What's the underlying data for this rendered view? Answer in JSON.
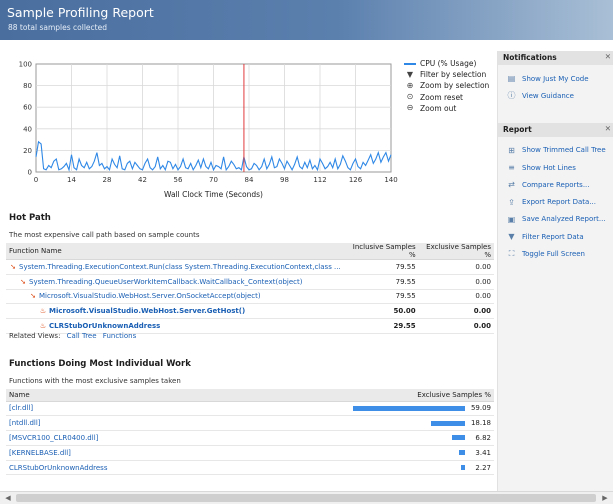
{
  "header": {
    "title": "Sample Profiling Report",
    "subtitle": "88 total samples collected"
  },
  "chart_data": {
    "type": "line",
    "title": "",
    "xlabel": "Wall Clock Time (Seconds)",
    "ylabel": "",
    "xlim": [
      0,
      140
    ],
    "ylim": [
      0,
      100
    ],
    "x_ticks": [
      0,
      14,
      28,
      42,
      56,
      70,
      84,
      98,
      112,
      126,
      140
    ],
    "y_ticks": [
      0,
      20,
      40,
      60,
      80,
      100
    ],
    "grid": true,
    "legend": "right",
    "selection_marker_x": 82,
    "series": [
      {
        "name": "CPU (% Usage)",
        "color": "#2f88e6",
        "x": [
          0,
          1,
          2,
          3,
          4,
          5,
          6,
          7,
          8,
          9,
          10,
          11,
          12,
          13,
          14,
          15,
          16,
          17,
          18,
          19,
          20,
          21,
          22,
          23,
          24,
          25,
          26,
          27,
          28,
          29,
          30,
          31,
          32,
          33,
          34,
          35,
          36,
          37,
          38,
          39,
          40,
          41,
          42,
          43,
          44,
          45,
          46,
          47,
          48,
          49,
          50,
          51,
          52,
          53,
          54,
          55,
          56,
          57,
          58,
          59,
          60,
          61,
          62,
          63,
          64,
          65,
          66,
          67,
          68,
          69,
          70,
          71,
          72,
          73,
          74,
          75,
          76,
          77,
          78,
          79,
          80,
          81,
          82,
          83,
          84,
          85,
          86,
          87,
          88,
          89,
          90,
          91,
          92,
          93,
          94,
          95,
          96,
          97,
          98,
          99,
          100,
          101,
          102,
          103,
          104,
          105,
          106,
          107,
          108,
          109,
          110,
          111,
          112,
          113,
          114,
          115,
          116,
          117,
          118,
          119,
          120,
          121,
          122,
          123,
          124,
          125,
          126,
          127,
          128,
          129,
          130,
          131,
          132,
          133,
          134,
          135,
          136,
          137,
          138,
          139,
          140
        ],
        "values": [
          14,
          28,
          26,
          3,
          2,
          6,
          4,
          10,
          12,
          2,
          3,
          5,
          8,
          2,
          16,
          4,
          2,
          12,
          6,
          4,
          9,
          3,
          5,
          10,
          18,
          6,
          8,
          3,
          5,
          2,
          12,
          7,
          4,
          15,
          3,
          2,
          8,
          10,
          3,
          9,
          6,
          3,
          2,
          8,
          12,
          4,
          2,
          5,
          14,
          3,
          6,
          2,
          10,
          9,
          3,
          7,
          2,
          5,
          12,
          4,
          3,
          8,
          2,
          6,
          11,
          4,
          12,
          5,
          3,
          9,
          2,
          6,
          5,
          3,
          14,
          2,
          5,
          10,
          7,
          3,
          4,
          2,
          14,
          5,
          2,
          3,
          8,
          6,
          2,
          5,
          12,
          3,
          7,
          14,
          4,
          5,
          12,
          8,
          3,
          10,
          6,
          2,
          7,
          14,
          5,
          3,
          9,
          4,
          11,
          3,
          6,
          2,
          12,
          8,
          3,
          5,
          9,
          4,
          12,
          3,
          7,
          15,
          10,
          4,
          2,
          8,
          12,
          5,
          3,
          9,
          6,
          11,
          16,
          8,
          12,
          18,
          9,
          14,
          18,
          10,
          16
        ]
      }
    ]
  },
  "legend": {
    "items": [
      {
        "label": "CPU (% Usage)",
        "icon": "line-swatch"
      },
      {
        "label": "Filter by selection",
        "icon": "filter-icon"
      },
      {
        "label": "Zoom by selection",
        "icon": "zoom-in-icon"
      },
      {
        "label": "Zoom reset",
        "icon": "zoom-reset-icon"
      },
      {
        "label": "Zoom out",
        "icon": "zoom-out-icon"
      }
    ]
  },
  "hot_path": {
    "title": "Hot Path",
    "desc": "The most expensive call path based on sample counts",
    "columns": [
      "Function Name",
      "Inclusive Samples %",
      "Exclusive Samples %"
    ],
    "rows": [
      {
        "name": "System.Threading.ExecutionContext.Run(class System.Threading.ExecutionContext,class ...",
        "inclusive": "79.55",
        "exclusive": "0.00",
        "indent": 0,
        "bold": false,
        "icon": "hot-path-arrow-icon"
      },
      {
        "name": "System.Threading.QueueUserWorkItemCallback.WaitCallback_Context(object)",
        "inclusive": "79.55",
        "exclusive": "0.00",
        "indent": 1,
        "bold": false,
        "icon": "hot-path-arrow-icon"
      },
      {
        "name": "Microsoft.VisualStudio.WebHost.Server.OnSocketAccept(object)",
        "inclusive": "79.55",
        "exclusive": "0.00",
        "indent": 2,
        "bold": false,
        "icon": "hot-path-arrow-icon"
      },
      {
        "name": "Microsoft.VisualStudio.WebHost.Server.GetHost()",
        "inclusive": "50.00",
        "exclusive": "0.00",
        "indent": 3,
        "bold": true,
        "icon": "flame-icon"
      },
      {
        "name": "CLRStubOrUnknownAddress",
        "inclusive": "29.55",
        "exclusive": "0.00",
        "indent": 3,
        "bold": true,
        "icon": "flame-icon"
      }
    ]
  },
  "related": {
    "label": "Related Views:",
    "links": [
      "Call Tree",
      "Functions"
    ]
  },
  "individual_work": {
    "title": "Functions Doing Most Individual Work",
    "desc": "Functions with the most exclusive samples taken",
    "columns": [
      "Name",
      "Exclusive Samples %"
    ],
    "rows": [
      {
        "name": "[clr.dll]",
        "value": "59.09",
        "pct": 59.09
      },
      {
        "name": "[ntdll.dll]",
        "value": "18.18",
        "pct": 18.18
      },
      {
        "name": "[MSVCR100_CLR0400.dll]",
        "value": "6.82",
        "pct": 6.82
      },
      {
        "name": "[KERNELBASE.dll]",
        "value": "3.41",
        "pct": 3.41
      },
      {
        "name": "CLRStubOrUnknownAddress",
        "value": "2.27",
        "pct": 2.27
      }
    ]
  },
  "sidebar": {
    "notifications": {
      "title": "Notifications",
      "items": [
        {
          "label": "Show Just My Code",
          "icon": "code-icon"
        },
        {
          "label": "View Guidance",
          "icon": "info-icon"
        }
      ]
    },
    "report": {
      "title": "Report",
      "items": [
        {
          "label": "Show Trimmed Call Tree",
          "icon": "tree-icon"
        },
        {
          "label": "Show Hot Lines",
          "icon": "hot-lines-icon"
        },
        {
          "label": "Compare Reports...",
          "icon": "compare-icon"
        },
        {
          "label": "Export Report Data...",
          "icon": "export-icon"
        },
        {
          "label": "Save Analyzed Report...",
          "icon": "save-icon"
        },
        {
          "label": "Filter Report Data",
          "icon": "filter-icon"
        },
        {
          "label": "Toggle Full Screen",
          "icon": "fullscreen-icon"
        }
      ]
    }
  }
}
